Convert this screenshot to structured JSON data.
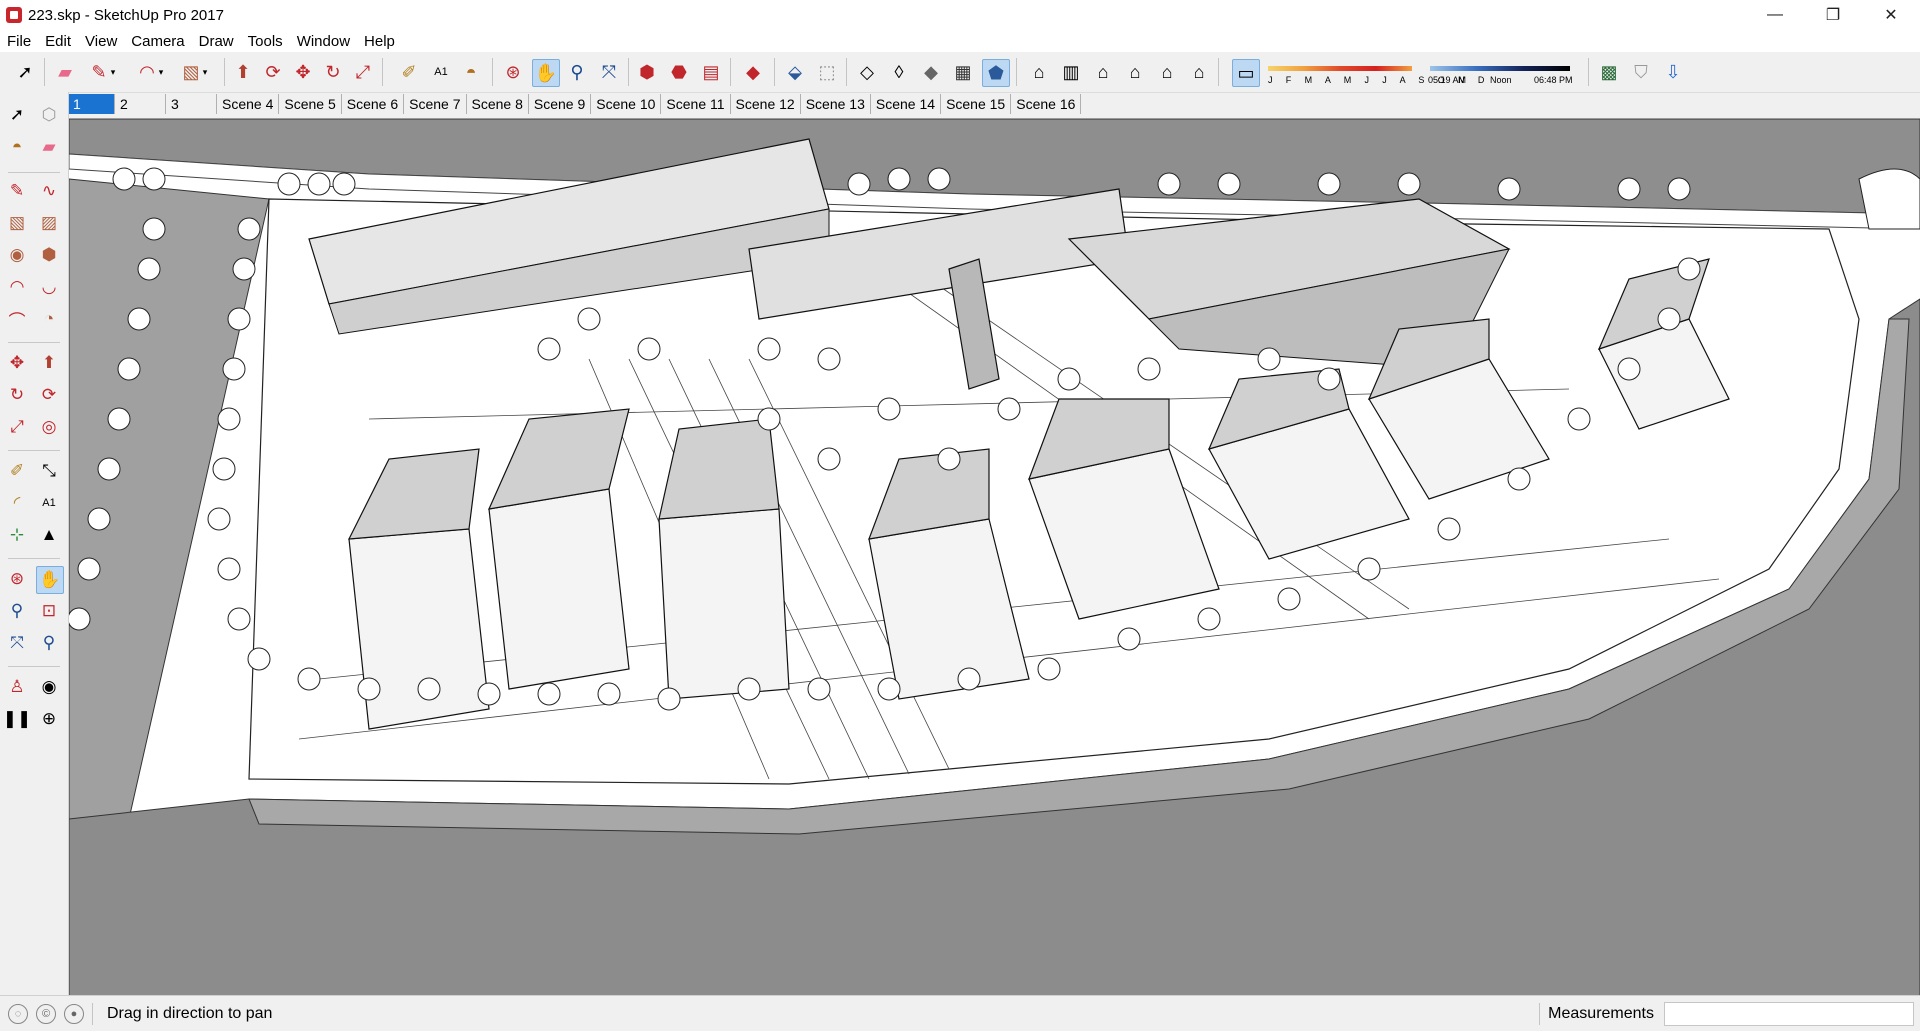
{
  "window": {
    "title": "223.skp - SketchUp Pro 2017",
    "minimize_glyph": "—",
    "maximize_glyph": "❐",
    "close_glyph": "✕"
  },
  "menu": [
    "File",
    "Edit",
    "View",
    "Camera",
    "Draw",
    "Tools",
    "Window",
    "Help"
  ],
  "toolbar": {
    "icons": [
      "select-icon",
      "eraser-icon",
      "pencil-icon",
      "arc-icon",
      "rectangle-icon",
      "push-pull-icon",
      "rotate-icon",
      "move-icon",
      "follow-me-icon",
      "scale-icon",
      "tape-measure-icon",
      "text-icon",
      "paint-bucket-icon",
      "orbit-icon",
      "pan-icon",
      "zoom-icon",
      "zoom-extents-icon",
      "warehouse-icon",
      "extension-warehouse-icon",
      "layout-icon",
      "ruby-icon",
      "xray-icon",
      "back-edges-icon",
      "wireframe-icon",
      "hidden-line-icon",
      "shaded-icon",
      "shaded-textures-icon",
      "monochrome-icon",
      "iso-view-icon",
      "top-view-icon",
      "front-view-icon",
      "right-view-icon",
      "back-view-icon",
      "left-view-icon",
      "shadows-toggle-icon",
      "geo-location-icon",
      "sandbox-icon",
      "export-icon"
    ],
    "shadow_months": "J F M A M J J A S O N D",
    "time_start": "05:19 AM",
    "time_noon": "Noon",
    "time_end": "06:48 PM"
  },
  "scenes": {
    "active": "1",
    "tabs": [
      "1",
      "2",
      "3",
      "Scene 4",
      "Scene 5",
      "Scene 6",
      "Scene 7",
      "Scene 8",
      "Scene 9",
      "Scene 10",
      "Scene 11",
      "Scene 12",
      "Scene 13",
      "Scene 14",
      "Scene 15",
      "Scene 16"
    ]
  },
  "status": {
    "hint": "Drag in direction to pan",
    "measurements_label": "Measurements",
    "measurements_value": ""
  },
  "colors": {
    "accent": "#1a73d0",
    "active_tool": "#bcd8f2",
    "sketchup_red": "#c8262c",
    "ground_dark": "#8c8c8c",
    "ground_mid": "#a8a8a8"
  }
}
